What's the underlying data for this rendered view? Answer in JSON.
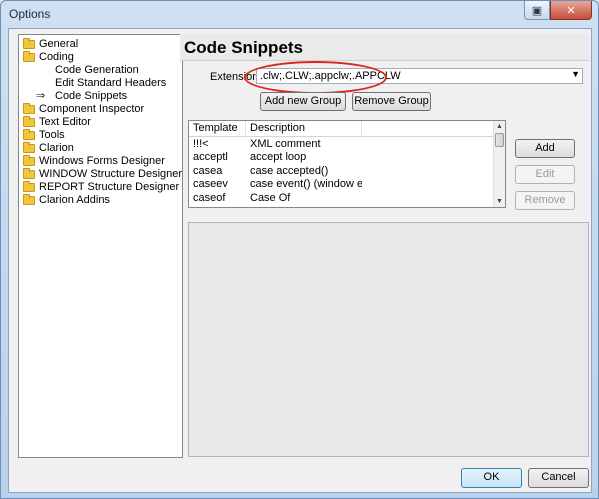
{
  "window": {
    "title": "Options"
  },
  "tree": {
    "items": [
      {
        "label": "General",
        "level": 0,
        "folder": true
      },
      {
        "label": "Coding",
        "level": 0,
        "folder": true
      },
      {
        "label": "Code Generation",
        "level": 1,
        "folder": false
      },
      {
        "label": "Edit Standard Headers",
        "level": 1,
        "folder": false
      },
      {
        "label": "Code Snippets",
        "level": 1,
        "folder": false,
        "selected": true
      },
      {
        "label": "Component Inspector",
        "level": 0,
        "folder": true
      },
      {
        "label": "Text Editor",
        "level": 0,
        "folder": true
      },
      {
        "label": "Tools",
        "level": 0,
        "folder": true
      },
      {
        "label": "Clarion",
        "level": 0,
        "folder": true
      },
      {
        "label": "Windows Forms Designer",
        "level": 0,
        "folder": true
      },
      {
        "label": "WINDOW Structure Designer",
        "level": 0,
        "folder": true
      },
      {
        "label": "REPORT Structure Designer",
        "level": 0,
        "folder": true
      },
      {
        "label": "Clarion Addins",
        "level": 0,
        "folder": true
      }
    ]
  },
  "panel": {
    "title": "Code Snippets",
    "extensions_label": "Extensions",
    "extensions_value": ".clw;.CLW;.appclw;.APPCLW",
    "add_group_label": "Add new Group",
    "remove_group_label": "Remove Group"
  },
  "grid": {
    "columns": [
      "Template",
      "Description"
    ],
    "rows": [
      [
        "!!!<",
        "XML comment"
      ],
      [
        "acceptl",
        "accept loop"
      ],
      [
        "casea",
        "case accepted()"
      ],
      [
        "caseev",
        "case event() (window ev..."
      ],
      [
        "caseof",
        "Case Of"
      ]
    ]
  },
  "side_buttons": {
    "add": "Add",
    "edit": "Edit",
    "remove": "Remove"
  },
  "footer": {
    "ok": "OK",
    "cancel": "Cancel"
  },
  "colors": {
    "highlight": "#d9261c",
    "folder": "#f3c53d"
  }
}
